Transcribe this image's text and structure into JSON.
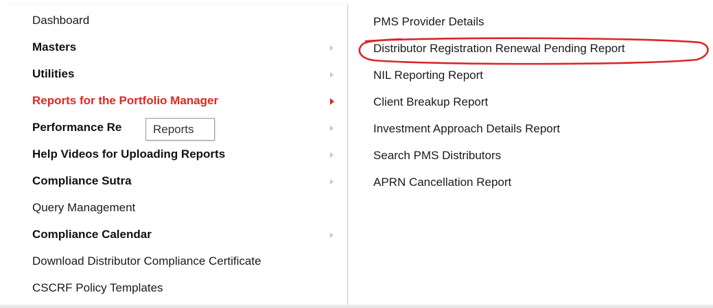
{
  "left_menu": {
    "items": [
      {
        "label": "Dashboard",
        "style": "normal",
        "has_submenu": false
      },
      {
        "label": "Masters",
        "style": "bold",
        "has_submenu": true
      },
      {
        "label": "Utilities",
        "style": "bold",
        "has_submenu": true
      },
      {
        "label": "Reports for the Portfolio Manager",
        "style": "active",
        "has_submenu": true
      },
      {
        "label": "Performance Re",
        "style": "bold",
        "has_submenu": true
      },
      {
        "label": "Help Videos for Uploading Reports",
        "style": "bold",
        "has_submenu": true
      },
      {
        "label": "Compliance Sutra",
        "style": "bold",
        "has_submenu": true
      },
      {
        "label": "Query Management",
        "style": "normal",
        "has_submenu": false
      },
      {
        "label": "Compliance Calendar",
        "style": "bold",
        "has_submenu": true
      },
      {
        "label": "Download Distributor Compliance Certificate",
        "style": "normal",
        "has_submenu": false
      },
      {
        "label": "CSCRF Policy Templates",
        "style": "normal",
        "has_submenu": false
      }
    ]
  },
  "tooltip": {
    "text": "Reports"
  },
  "submenu": {
    "items": [
      {
        "label": "PMS Provider Details"
      },
      {
        "label": "Distributor Registration Renewal Pending Report",
        "highlighted": true
      },
      {
        "label": "NIL Reporting Report"
      },
      {
        "label": "Client Breakup Report"
      },
      {
        "label": "Investment Approach Details Report"
      },
      {
        "label": "Search PMS Distributors"
      },
      {
        "label": "APRN Cancellation Report"
      }
    ]
  },
  "colors": {
    "active_text": "#e32620",
    "highlight_ellipse": "#d9262a",
    "chevron_inactive": "#c8c8c8"
  },
  "icons": {
    "submenu_indicator": "chevron-right-icon"
  }
}
